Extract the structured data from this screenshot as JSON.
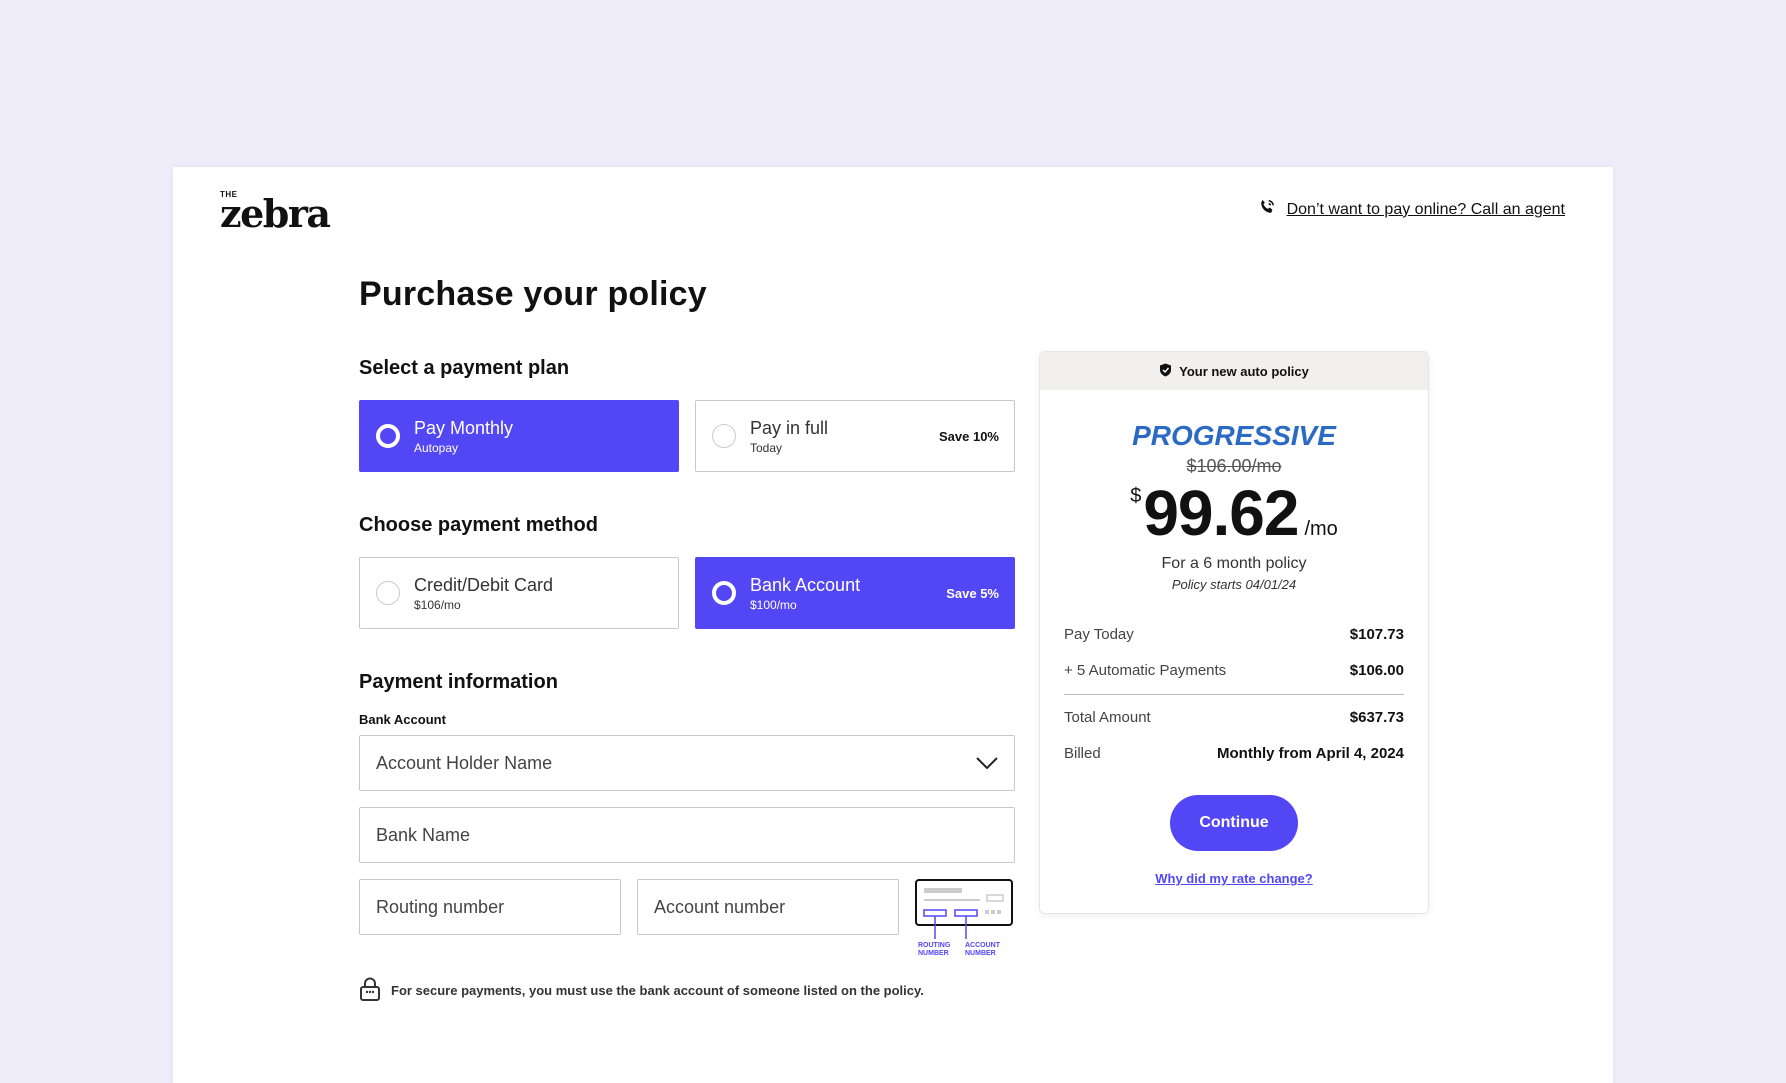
{
  "brand": {
    "the": "THE",
    "word": "zebra"
  },
  "header": {
    "agent_link": "Don’t want to pay online? Call an agent"
  },
  "page": {
    "title": "Purchase your policy"
  },
  "payment_plan": {
    "heading": "Select a payment plan",
    "options": [
      {
        "title": "Pay Monthly",
        "subtitle": "Autopay",
        "badge": "",
        "selected": true
      },
      {
        "title": "Pay in full",
        "subtitle": "Today",
        "badge": "Save 10%",
        "selected": false
      }
    ]
  },
  "payment_method": {
    "heading": "Choose payment method",
    "options": [
      {
        "title": "Credit/Debit Card",
        "subtitle": "$106/mo",
        "badge": "",
        "selected": false
      },
      {
        "title": "Bank Account",
        "subtitle": "$100/mo",
        "badge": "Save 5%",
        "selected": true
      }
    ]
  },
  "payment_info": {
    "heading": "Payment information",
    "bank_label": "Bank Account",
    "account_holder_placeholder": "Account Holder Name",
    "bank_name_placeholder": "Bank Name",
    "routing_placeholder": "Routing number",
    "account_placeholder": "Account number",
    "check_labels": {
      "routing": [
        "ROUTING",
        "NUMBER"
      ],
      "account": [
        "ACCOUNT",
        "NUMBER"
      ]
    },
    "secure_note": "For secure payments, you must use the bank account of someone listed on the policy."
  },
  "summary": {
    "header": "Your new auto policy",
    "carrier": "PROGRESSIVE",
    "old_price": "$106.00/mo",
    "currency": "$",
    "price": "99.62",
    "per": "/mo",
    "term": "For a 6 month policy",
    "starts": "Policy starts 04/01/24",
    "lines_top": [
      {
        "label": "Pay Today",
        "value": "$107.73"
      },
      {
        "label": "+ 5 Automatic Payments",
        "value": "$106.00"
      }
    ],
    "lines_bottom": [
      {
        "label": "Total Amount",
        "value": "$637.73"
      },
      {
        "label": "Billed",
        "value": "Monthly from April 4, 2024"
      }
    ],
    "continue_label": "Continue",
    "why_link": "Why did my rate change?"
  },
  "colors": {
    "accent": "#5347f5",
    "background": "#edecf8",
    "carrier": "#2a6ac5"
  }
}
